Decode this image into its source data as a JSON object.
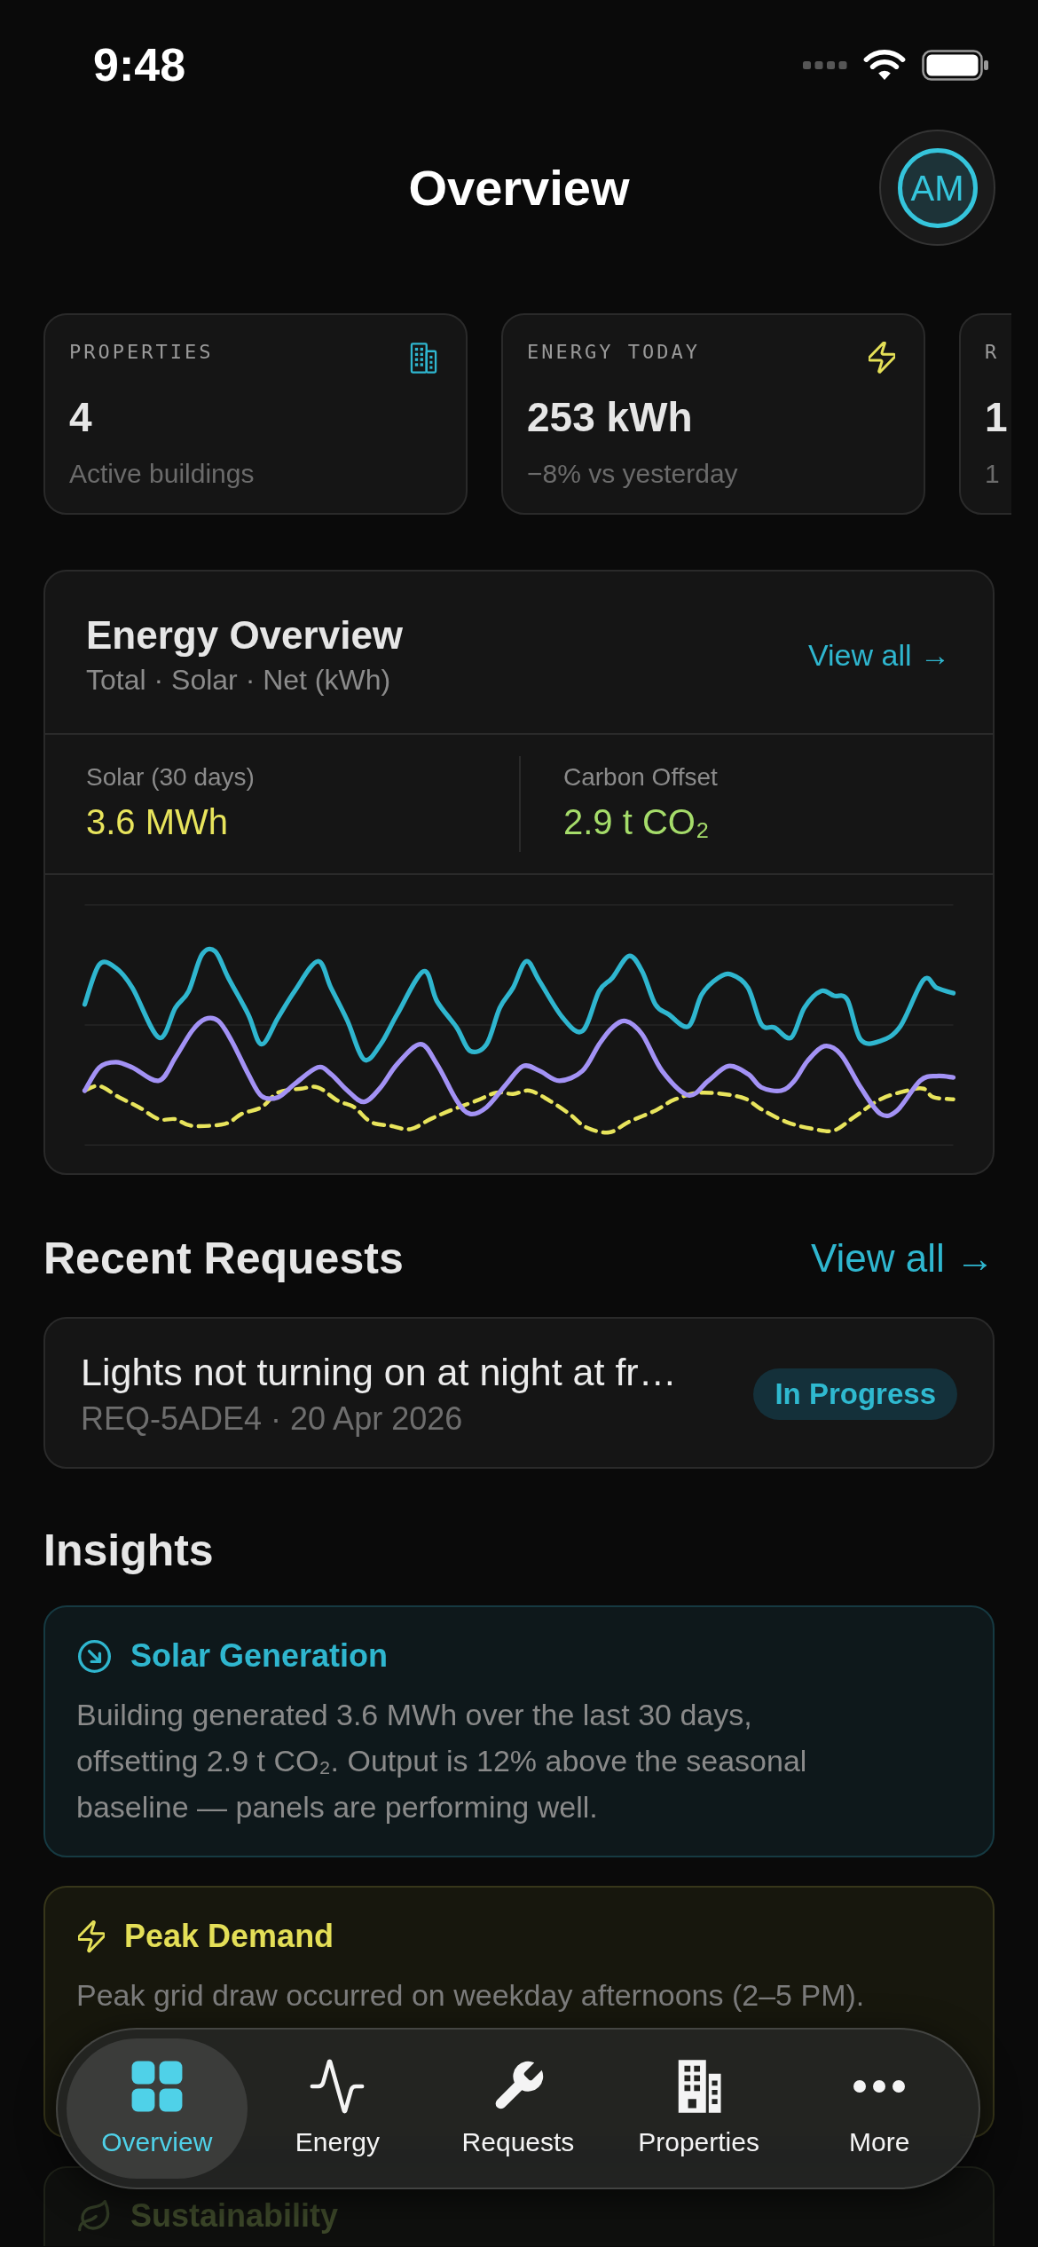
{
  "status_bar": {
    "time": "9:48"
  },
  "header": {
    "title": "Overview",
    "avatar_initials": "AM"
  },
  "stat_cards": [
    {
      "label": "PROPERTIES",
      "value": "4",
      "caption": "Active buildings"
    },
    {
      "label": "ENERGY TODAY",
      "value": "253 kWh",
      "caption": "−8% vs yesterday"
    },
    {
      "label": "R",
      "value": "1",
      "caption": "1"
    }
  ],
  "energy_overview": {
    "title": "Energy Overview",
    "subtitle": "Total · Solar · Net (kWh)",
    "link": "View all →",
    "stats": [
      {
        "label": "Solar (30 days)",
        "value": "3.6 MWh",
        "color": "#e8e45c"
      },
      {
        "label": "Carbon Offset",
        "value": "2.9 t CO₂",
        "color": "#a5dc6a"
      }
    ]
  },
  "recent_requests": {
    "title": "Recent Requests",
    "link": "View all →",
    "items": [
      {
        "title": "Lights not turning on at night at fr…",
        "meta": "REQ-5ADE4 · 20 Apr 2026",
        "status": "In Progress"
      }
    ]
  },
  "insights": {
    "title": "Insights",
    "items": [
      {
        "kind": "solar",
        "title": "Solar Generation",
        "body": "Building generated 3.6 MWh over the last 30 days, offsetting 2.9 t CO₂. Output is 12% above the seasonal baseline — panels are performing well."
      },
      {
        "kind": "peak",
        "title": "Peak Demand",
        "body": "Peak grid draw occurred on weekday afternoons (2–5 PM)."
      },
      {
        "kind": "sustainability",
        "title": "Sustainability"
      }
    ]
  },
  "tab_bar": [
    {
      "label": "Overview",
      "selected": true
    },
    {
      "label": "Energy",
      "selected": false
    },
    {
      "label": "Requests",
      "selected": false
    },
    {
      "label": "Properties",
      "selected": false
    },
    {
      "label": "More",
      "selected": false
    }
  ]
}
